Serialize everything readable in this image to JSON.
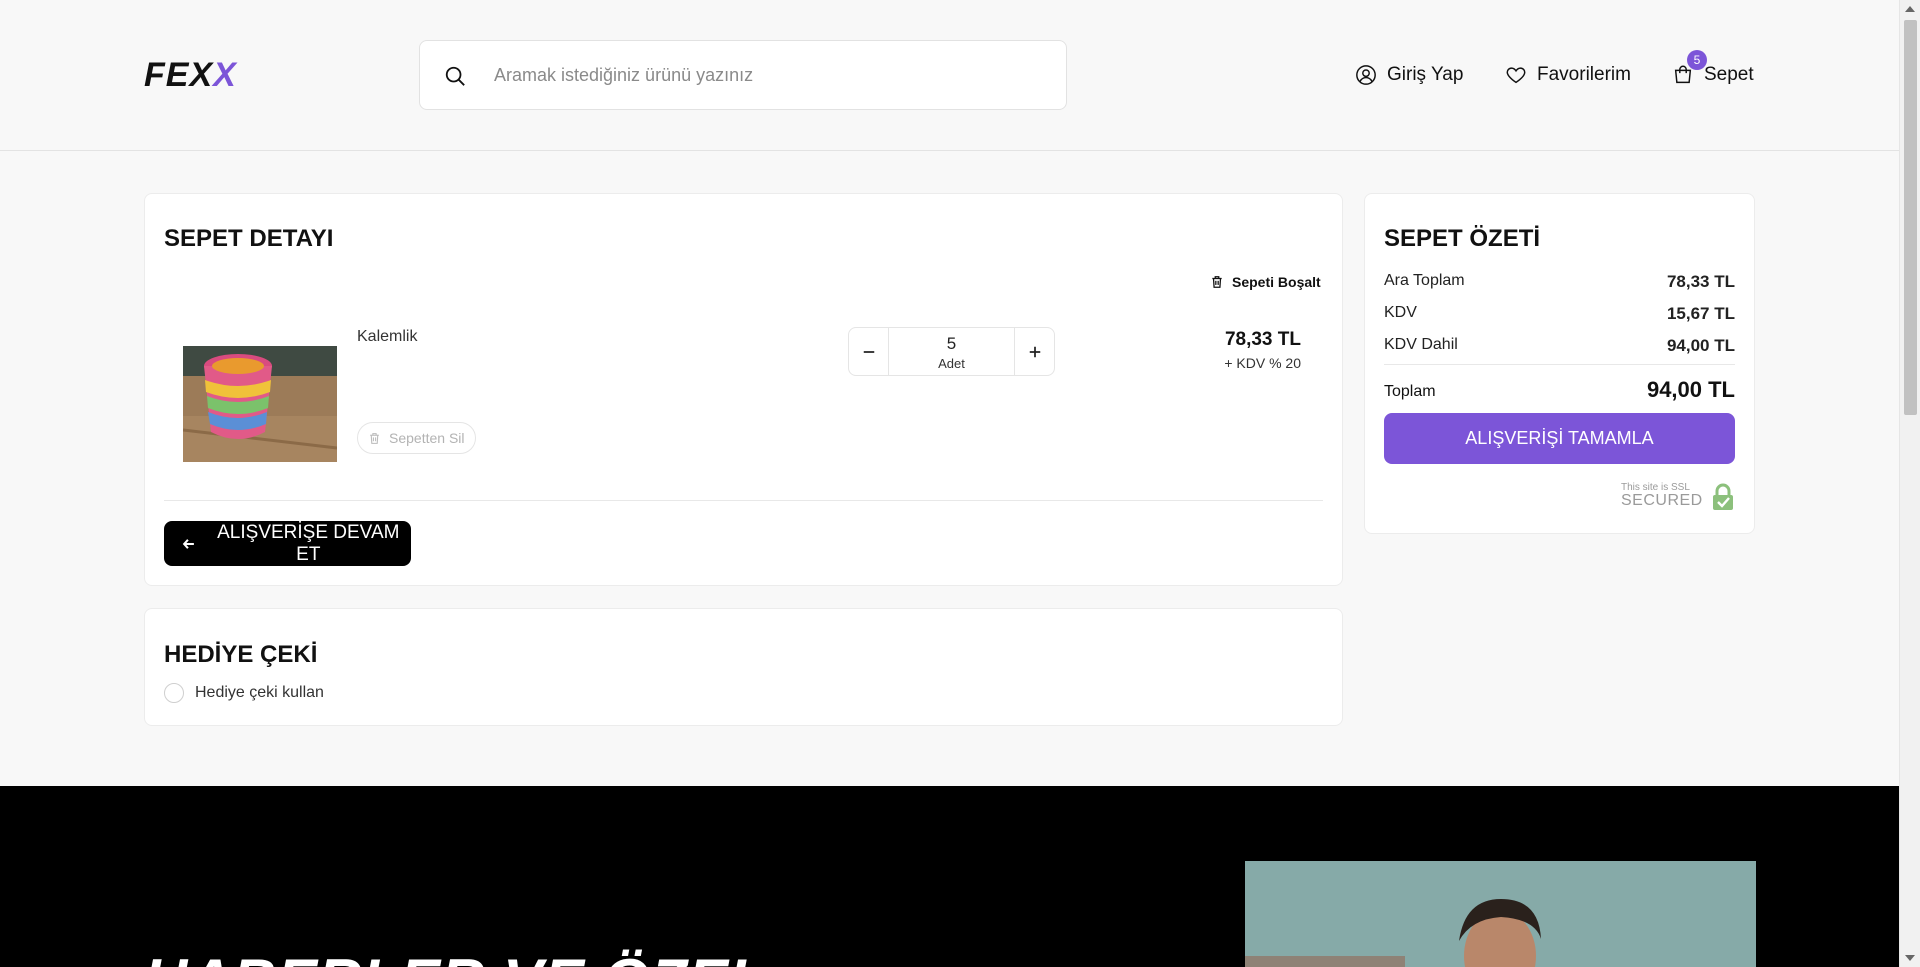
{
  "header": {
    "logo": {
      "part1": "FEX",
      "part2": "X"
    },
    "search": {
      "placeholder": "Aramak istediğiniz ürünü yazınız"
    },
    "nav": {
      "login": "Giriş Yap",
      "favorites": "Favorilerim",
      "cart": "Sepet",
      "cart_count": "5"
    }
  },
  "cart": {
    "title": "SEPET DETAYI",
    "empty_label": "Sepeti Boşalt",
    "item": {
      "name": "Kalemlik",
      "remove_label": "Sepetten Sil",
      "quantity": "5",
      "unit": "Adet",
      "price": "78,33 TL",
      "vat": "+ KDV % 20"
    },
    "continue_label": "ALIŞVERİŞE DEVAM ET"
  },
  "gift": {
    "title": "HEDİYE ÇEKİ",
    "option_label": "Hediye çeki kullan"
  },
  "summary": {
    "title": "SEPET ÖZETİ",
    "rows": [
      {
        "label": "Ara Toplam",
        "value": "78,33 TL"
      },
      {
        "label": "KDV",
        "value": "15,67 TL"
      },
      {
        "label": "KDV Dahil",
        "value": "94,00 TL"
      }
    ],
    "total_label": "Toplam",
    "total_value": "94,00 TL",
    "checkout_label": "ALIŞVERİŞİ TAMAMLA",
    "ssl_line1": "This site is SSL",
    "ssl_line2": "SECURED"
  },
  "footer": {
    "heading": "HABERLER VE ÖZEL"
  },
  "colors": {
    "accent": "#7c55d8",
    "dark": "#000000",
    "background": "#f8f8f8"
  }
}
